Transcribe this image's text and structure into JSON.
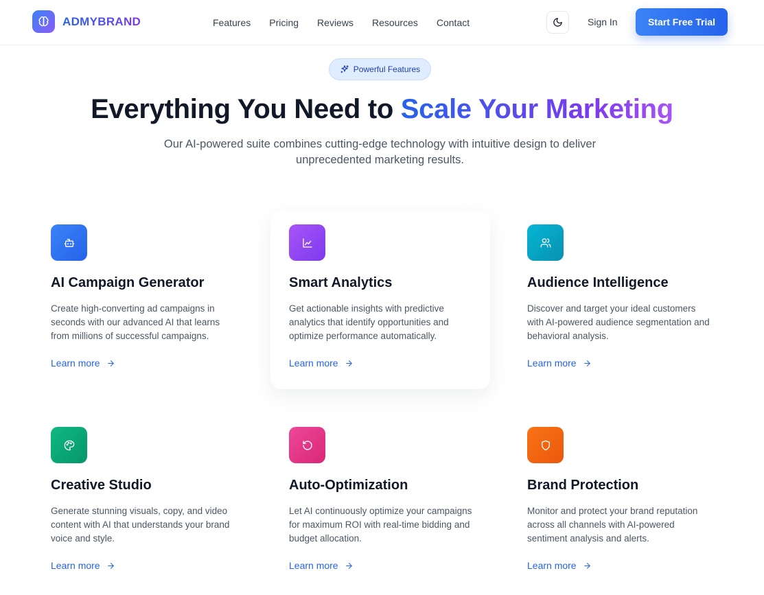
{
  "header": {
    "brand": "ADMYBRAND",
    "nav": [
      "Features",
      "Pricing",
      "Reviews",
      "Resources",
      "Contact"
    ],
    "sign_in": "Sign In",
    "cta": "Start Free Trial"
  },
  "hero": {
    "badge": "Powerful Features",
    "title_plain": "Everything You Need to ",
    "title_highlight": "Scale Your Marketing",
    "subtitle": "Our AI-powered suite combines cutting-edge technology with intuitive design to deliver unprecedented marketing results."
  },
  "features": [
    {
      "icon": "bot-icon",
      "color_from": "#3b82f6",
      "color_to": "#2563eb",
      "title": "AI Campaign Generator",
      "description": "Create high-converting ad campaigns in seconds with our advanced AI that learns from millions of successful campaigns.",
      "link": "Learn more"
    },
    {
      "icon": "line-chart-icon",
      "color_from": "#a855f7",
      "color_to": "#7c3aed",
      "title": "Smart Analytics",
      "description": "Get actionable insights with predictive analytics that identify opportunities and optimize performance automatically.",
      "link": "Learn more"
    },
    {
      "icon": "users-icon",
      "color_from": "#06b6d4",
      "color_to": "#0891b2",
      "title": "Audience Intelligence",
      "description": "Discover and target your ideal customers with AI-powered audience segmentation and behavioral analysis.",
      "link": "Learn more"
    },
    {
      "icon": "palette-icon",
      "color_from": "#10b981",
      "color_to": "#059669",
      "title": "Creative Studio",
      "description": "Generate stunning visuals, copy, and video content with AI that understands your brand voice and style.",
      "link": "Learn more"
    },
    {
      "icon": "rotate-icon",
      "color_from": "#ec4899",
      "color_to": "#db2777",
      "title": "Auto-Optimization",
      "description": "Let AI continuously optimize your campaigns for maximum ROI with real-time bidding and budget allocation.",
      "link": "Learn more"
    },
    {
      "icon": "shield-icon",
      "color_from": "#f97316",
      "color_to": "#ea580c",
      "title": "Brand Protection",
      "description": "Monitor and protect your brand reputation across all channels with AI-powered sentiment analysis and alerts.",
      "link": "Learn more"
    }
  ]
}
